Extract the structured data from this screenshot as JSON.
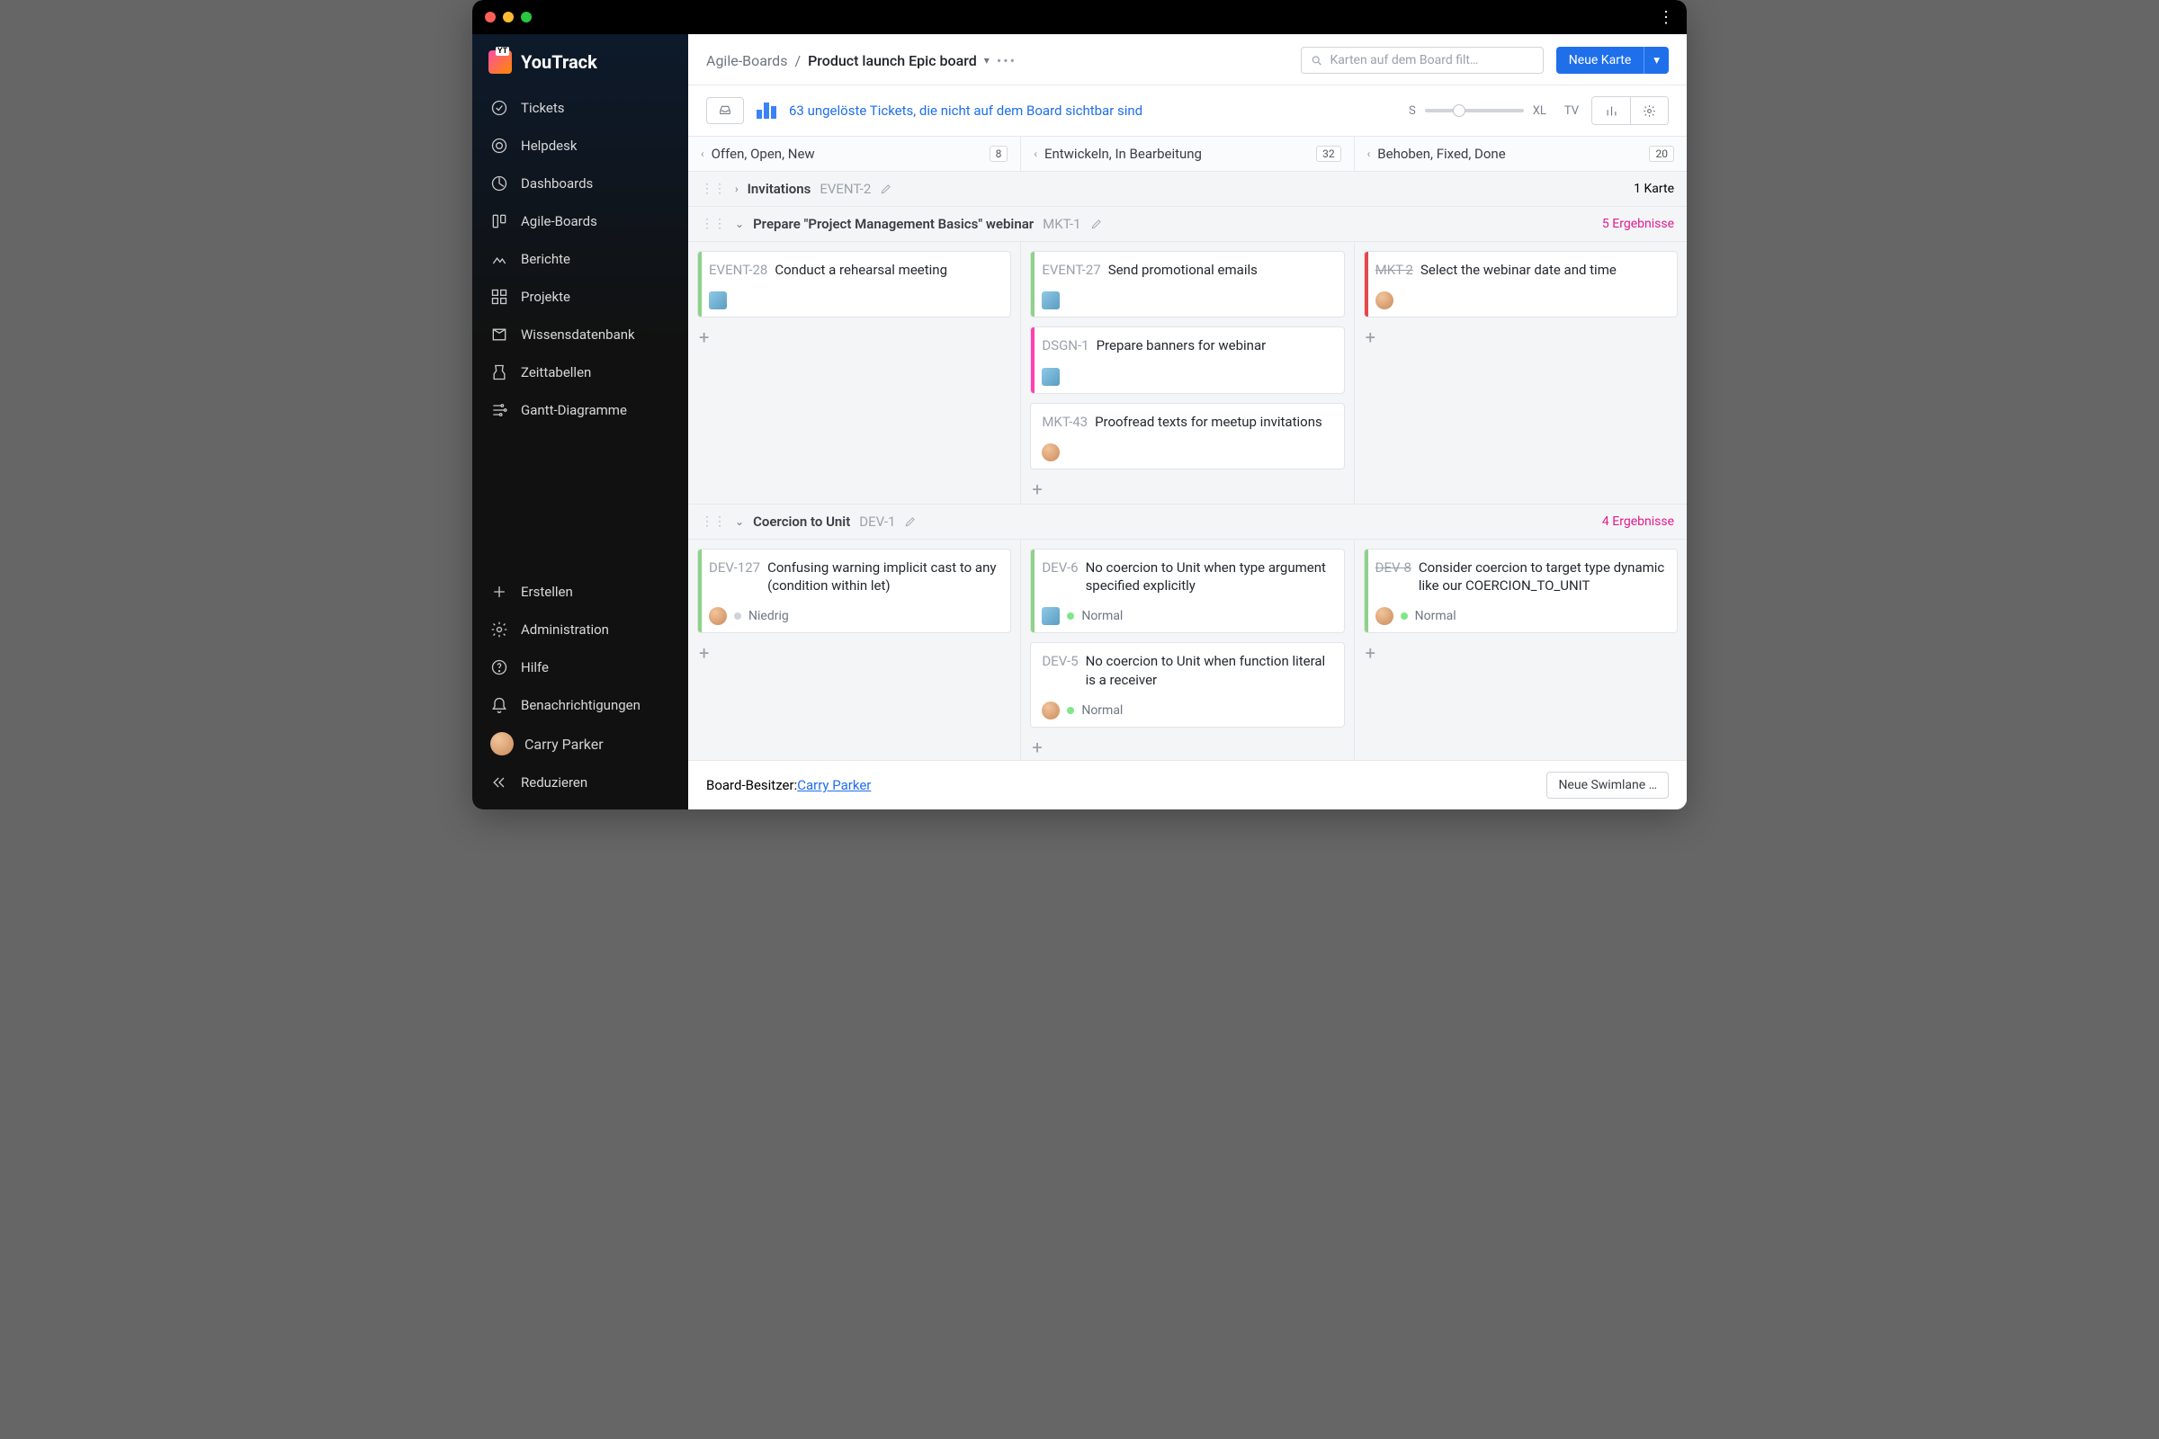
{
  "brand": "YouTrack",
  "sidebar": {
    "items": [
      {
        "label": "Tickets"
      },
      {
        "label": "Helpdesk"
      },
      {
        "label": "Dashboards"
      },
      {
        "label": "Agile-Boards"
      },
      {
        "label": "Berichte"
      },
      {
        "label": "Projekte"
      },
      {
        "label": "Wissensdatenbank"
      },
      {
        "label": "Zeittabellen"
      },
      {
        "label": "Gantt-Diagramme"
      }
    ],
    "bottom": [
      {
        "label": "Erstellen"
      },
      {
        "label": "Administration"
      },
      {
        "label": "Hilfe"
      },
      {
        "label": "Benachrichtigungen"
      }
    ],
    "user": "Carry Parker",
    "collapse": "Reduzieren"
  },
  "header": {
    "crumb_root": "Agile-Boards",
    "crumb_current": "Product launch Epic board",
    "search_placeholder": "Karten auf dem Board filt…",
    "new_card": "Neue Karte"
  },
  "toolbar": {
    "banner": "63 ungelöste Tickets, die nicht auf dem Board sichtbar sind",
    "size_s": "S",
    "size_xl": "XL",
    "tv": "TV"
  },
  "columns": [
    {
      "title": "Offen, Open, New",
      "count": "8"
    },
    {
      "title": "Entwickeln, In Bearbeitung",
      "count": "32"
    },
    {
      "title": "Behoben, Fixed, Done",
      "count": "20"
    }
  ],
  "swimlanes": [
    {
      "title": "Invitations",
      "key": "EVENT-2",
      "collapsed": true,
      "right": "1 Karte",
      "right_class": ""
    },
    {
      "title": "Prepare \"Project Management Basics\" webinar",
      "key": "MKT-1",
      "right": "5 Ergebnisse",
      "right_class": "magenta",
      "cols": [
        [
          {
            "key": "EVENT-28",
            "title": "Conduct a rehearsal meeting",
            "stripe": "#8dd28a",
            "av": "sq"
          }
        ],
        [
          {
            "key": "EVENT-27",
            "title": "Send promotional emails",
            "stripe": "#8dd28a",
            "av": "sq"
          },
          {
            "key": "DSGN-1",
            "title": "Prepare banners for webinar",
            "stripe": "#ff3fb4",
            "av": "sq"
          },
          {
            "key": "MKT-43",
            "title": "Proofread texts for meetup invitations",
            "stripe": "",
            "av": "round"
          }
        ],
        [
          {
            "key": "MKT-2",
            "title": "Select the webinar date and time",
            "stripe": "#e5484d",
            "av": "round",
            "strike": true
          }
        ]
      ]
    },
    {
      "title": "Coercion to Unit",
      "key": "DEV-1",
      "right": "4 Ergebnisse",
      "right_class": "magenta",
      "cols": [
        [
          {
            "key": "DEV-127",
            "title": "Confusing warning implicit cast to any (condition within let)",
            "stripe": "#8dd28a",
            "av": "round",
            "prio": {
              "color": "#d0d4d9",
              "label": "Niedrig"
            }
          }
        ],
        [
          {
            "key": "DEV-6",
            "title": "No coercion to Unit when type argument specified explicitly",
            "stripe": "#8dd28a",
            "av": "sq",
            "prio": {
              "color": "#7ee787",
              "label": "Normal"
            }
          },
          {
            "key": "DEV-5",
            "title": "No coercion to Unit when function literal is a receiver",
            "stripe": "",
            "av": "round",
            "prio": {
              "color": "#7ee787",
              "label": "Normal"
            }
          }
        ],
        [
          {
            "key": "DEV-8",
            "title": "Consider coercion to target type dynamic like our COERCION_TO_UNIT",
            "stripe": "#8dd28a",
            "av": "round",
            "strike": true,
            "prio": {
              "color": "#7ee787",
              "label": "Normal"
            }
          }
        ]
      ]
    }
  ],
  "footer": {
    "owner_label": "Board-Besitzer: ",
    "owner_name": "Carry Parker",
    "new_swimlane": "Neue Swimlane …"
  }
}
